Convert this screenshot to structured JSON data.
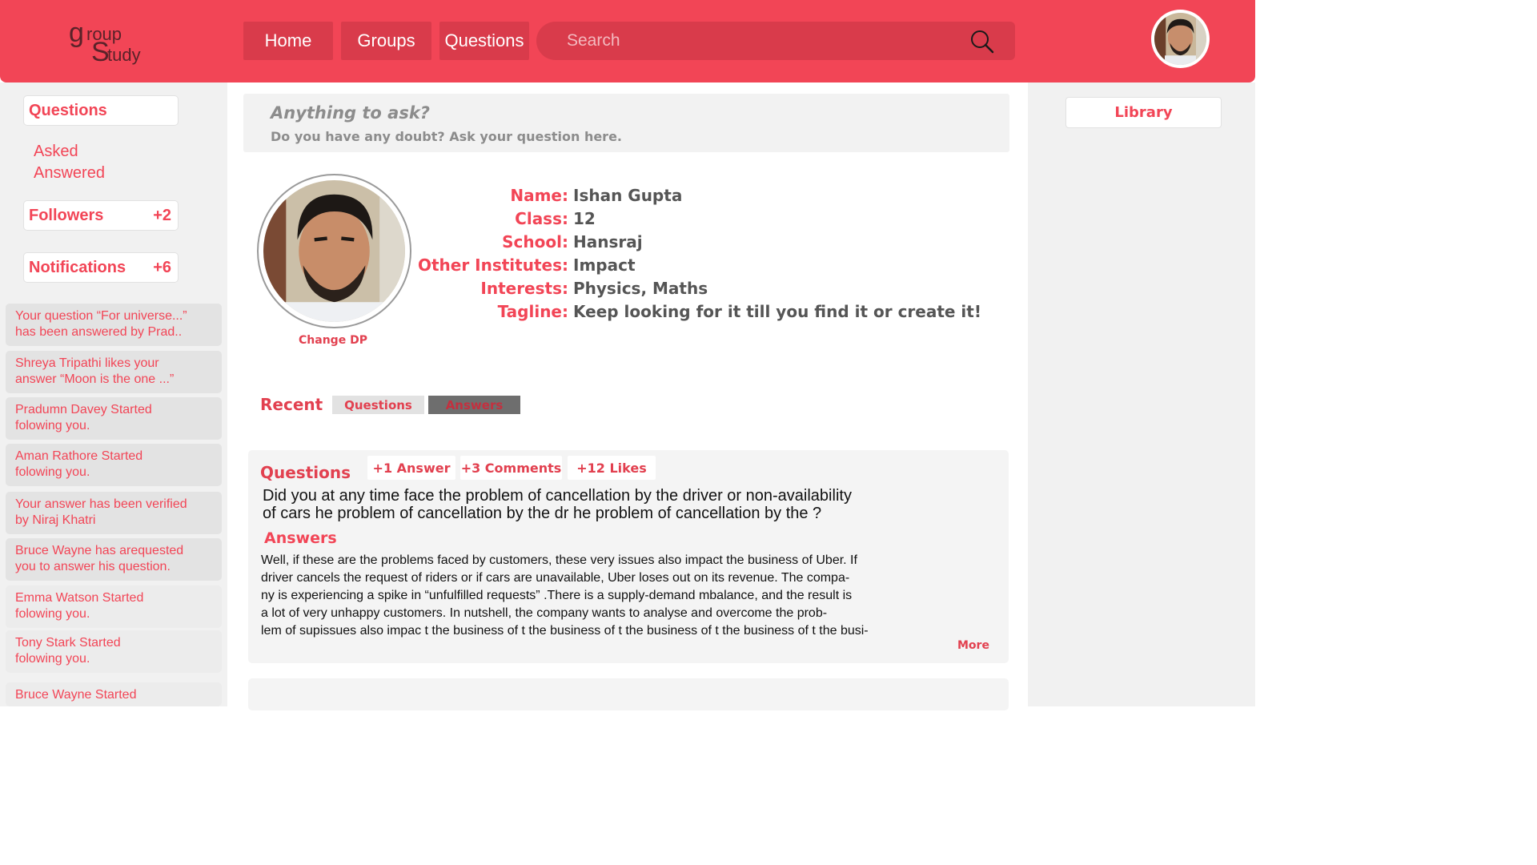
{
  "header": {
    "logo": {
      "g": "g",
      "roup": "roup",
      "s": "S",
      "tudy": "tudy"
    },
    "nav": [
      "Home",
      "Groups",
      "Questions"
    ],
    "search_placeholder": "Search",
    "accent": "#f24556"
  },
  "sidebar": {
    "questions_label": "Questions",
    "asked_label": "Asked",
    "answered_label": "Answered",
    "followers_label": "Followers",
    "followers_count": "+2",
    "notifications_label": "Notifications",
    "notifications_count": "+6",
    "notifications": [
      [
        "Your question “For universe...”",
        "has been answered by Prad.."
      ],
      [
        "Shreya Tripathi likes your",
        "answer “Moon is the one ...”"
      ],
      [
        "Pradumn Davey Started",
        "folowing you."
      ],
      [
        "Aman Rathore  Started",
        "folowing you."
      ],
      [
        "Your answer has been verified",
        "by Niraj Khatri"
      ],
      [
        "Bruce Wayne has arequested",
        "you to answer his question."
      ],
      [
        "Emma Watson  Started",
        "folowing you."
      ],
      [
        "Tony Stark  Started",
        "folowing you."
      ],
      [
        "Bruce Wayne  Started",
        ""
      ]
    ]
  },
  "ask": {
    "title": "Anything to ask?",
    "subtitle": "Do you have any doubt? Ask your question here."
  },
  "profile": {
    "change_dp": "Change DP",
    "fields": [
      {
        "label": "Name:",
        "value": "Ishan Gupta"
      },
      {
        "label": "Class:",
        "value": "12"
      },
      {
        "label": "School:",
        "value": "Hansraj"
      },
      {
        "label": "Other Institutes:",
        "value": "Impact"
      },
      {
        "label": "Interests:",
        "value": "Physics, Maths"
      },
      {
        "label": "Tagline:",
        "value": "Keep looking for it till you find it or create it!"
      }
    ]
  },
  "recent": {
    "label": "Recent",
    "tabs": [
      "Questions",
      "Answers"
    ]
  },
  "card": {
    "questions_label": "Questions",
    "chips": [
      "+1 Answer",
      "+3 Comments",
      "+12 Likes"
    ],
    "question_lines": [
      "Did you at any time face the problem of cancellation by the driver or non-availability",
      "of cars he problem of cancellation by the dr he problem of cancellation by the ?"
    ],
    "answers_label": "Answers",
    "answer_lines": [
      "Well, if these are the problems faced by customers, these very issues also impact the business of Uber. If",
      "driver cancels the request of riders or if cars are unavailable, Uber loses out on its revenue. The compa-",
      "ny is experiencing a spike in “unfulfilled requests” .There is a supply-demand mbalance, and the result is",
      "a lot of very unhappy customers. In nutshell, the company wants to analyse and overcome the prob-",
      "lem of supissues also impac t the business of t the business of t the business of t the business of t the busi-"
    ],
    "more": "More"
  },
  "right": {
    "library": "Library"
  }
}
